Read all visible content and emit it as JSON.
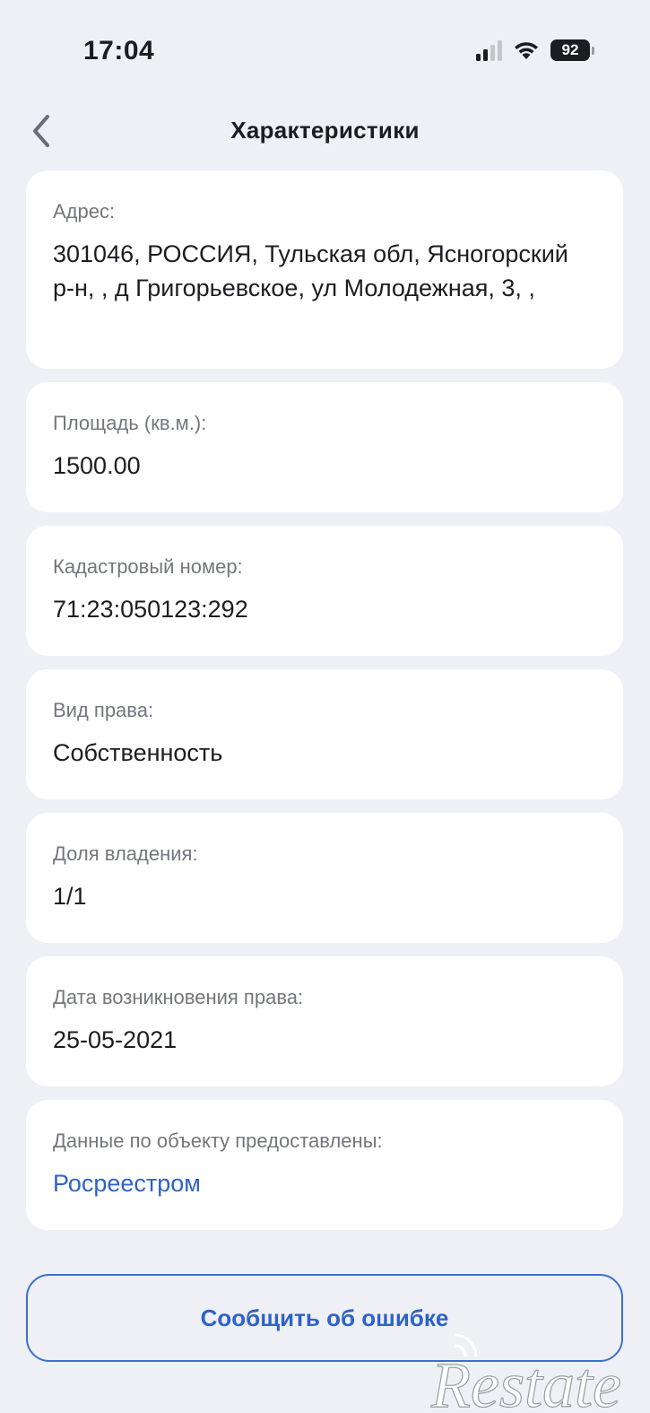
{
  "status_bar": {
    "time": "17:04",
    "battery": "92",
    "icons": [
      "signal-icon",
      "wifi-icon",
      "battery-icon"
    ]
  },
  "nav": {
    "title": "Характеристики",
    "back_icon": "chevron-left-icon"
  },
  "fields": [
    {
      "label": "Адрес:",
      "value": "301046, РОССИЯ, Тульская обл, Ясногорский р-н, , д Григорьевское, ул Молодежная, 3, ,"
    },
    {
      "label": "Площадь (кв.м.):",
      "value": "1500.00"
    },
    {
      "label": "Кадастровый номер:",
      "value": "71:23:050123:292"
    },
    {
      "label": "Вид права:",
      "value": "Собственность"
    },
    {
      "label": "Доля владения:",
      "value": "1/1"
    },
    {
      "label": "Дата возникновения права:",
      "value": "25-05-2021"
    },
    {
      "label": "Данные по объекту предоставлены:",
      "value": "Росреестром"
    }
  ],
  "report_button": {
    "label": "Сообщить об ошибке"
  },
  "watermark": {
    "text": "Restate"
  },
  "colors": {
    "background": "#eef0f6",
    "card": "#ffffff",
    "accent": "#2f62c6",
    "label": "#73767d",
    "text": "#1c1d22"
  }
}
